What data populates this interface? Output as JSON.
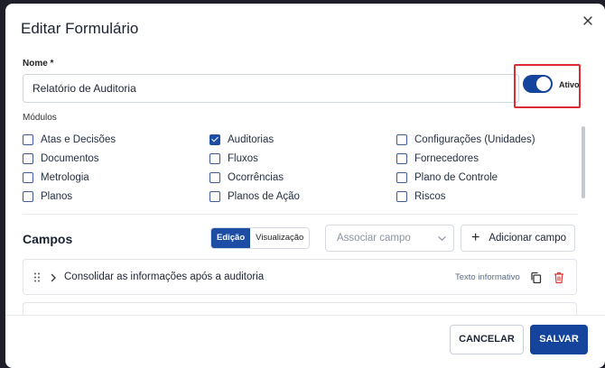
{
  "modal": {
    "title": "Editar Formulário",
    "close_icon": "close-icon"
  },
  "nome": {
    "label": "Nome *",
    "value": "Relatório de Auditoria"
  },
  "status": {
    "label": "Ativo",
    "enabled": true,
    "accent": "#14449b",
    "highlight_color": "#dd2b34"
  },
  "modulos": {
    "label": "Módulos",
    "items": [
      {
        "label": "Atas e Decisões",
        "checked": false
      },
      {
        "label": "Documentos",
        "checked": false
      },
      {
        "label": "Metrologia",
        "checked": false
      },
      {
        "label": "Planos",
        "checked": false
      },
      {
        "label": "Auditorias",
        "checked": true
      },
      {
        "label": "Fluxos",
        "checked": false
      },
      {
        "label": "Ocorrências",
        "checked": false
      },
      {
        "label": "Planos de Ação",
        "checked": false
      },
      {
        "label": "Configurações (Unidades)",
        "checked": false
      },
      {
        "label": "Fornecedores",
        "checked": false
      },
      {
        "label": "Plano de Controle",
        "checked": false
      },
      {
        "label": "Riscos",
        "checked": false
      }
    ]
  },
  "campos": {
    "title": "Campos",
    "mode_tabs": [
      {
        "label": "Edição",
        "active": true
      },
      {
        "label": "Visualização",
        "active": false
      }
    ],
    "associar_placeholder": "Associar campo",
    "add_label": "Adicionar campo",
    "fields": [
      {
        "name": "Consolidar as informações após a auditoria",
        "type": "Texto informativo"
      }
    ]
  },
  "footer": {
    "cancel_label": "CANCELAR",
    "save_label": "SALVAR"
  }
}
